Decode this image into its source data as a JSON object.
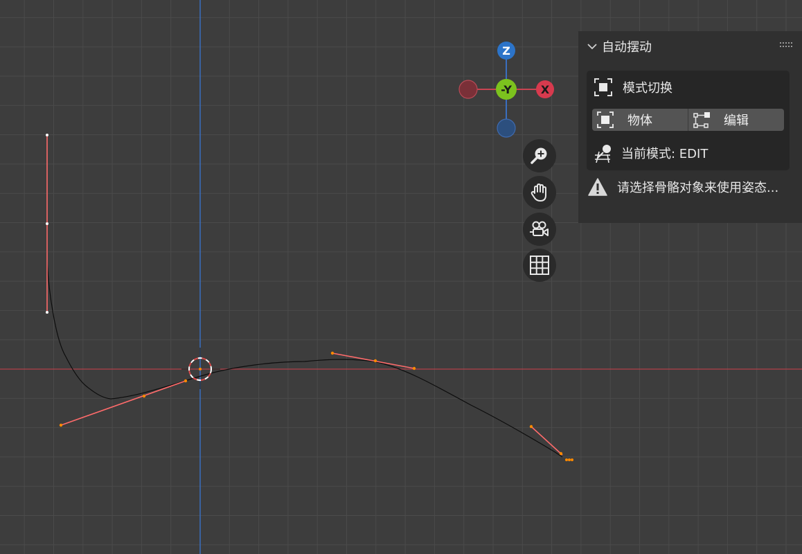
{
  "panel": {
    "title": "自动摆动",
    "mode_section_title": "模式切换",
    "object_button": "物体",
    "edit_button": "编辑",
    "current_mode": "当前模式: EDIT",
    "warning": "请选择骨骼对象来使用姿态..."
  },
  "gizmo": {
    "z_label": "Z",
    "y_label": "-Y",
    "x_label": "X"
  },
  "colors": {
    "background": "#3d3d3d",
    "grid": "#4b4b4b",
    "x_axis": "#c0404a",
    "y_axis": "#3a6fc0",
    "curve": "#0d0d0d",
    "handle": "#ff6b6b",
    "handle_point": "#ff8a00",
    "z_axis_gizmo": "#2c74c9",
    "x_axis_gizmo": "#d73a4e",
    "y_axis_gizmo": "#7cc21e",
    "panel_bg": "#303030"
  },
  "icons": {
    "zoom": "zoom-in-icon",
    "pan": "hand-icon",
    "camera": "camera-icon",
    "grid": "grid-icon",
    "warning": "warning-icon"
  }
}
